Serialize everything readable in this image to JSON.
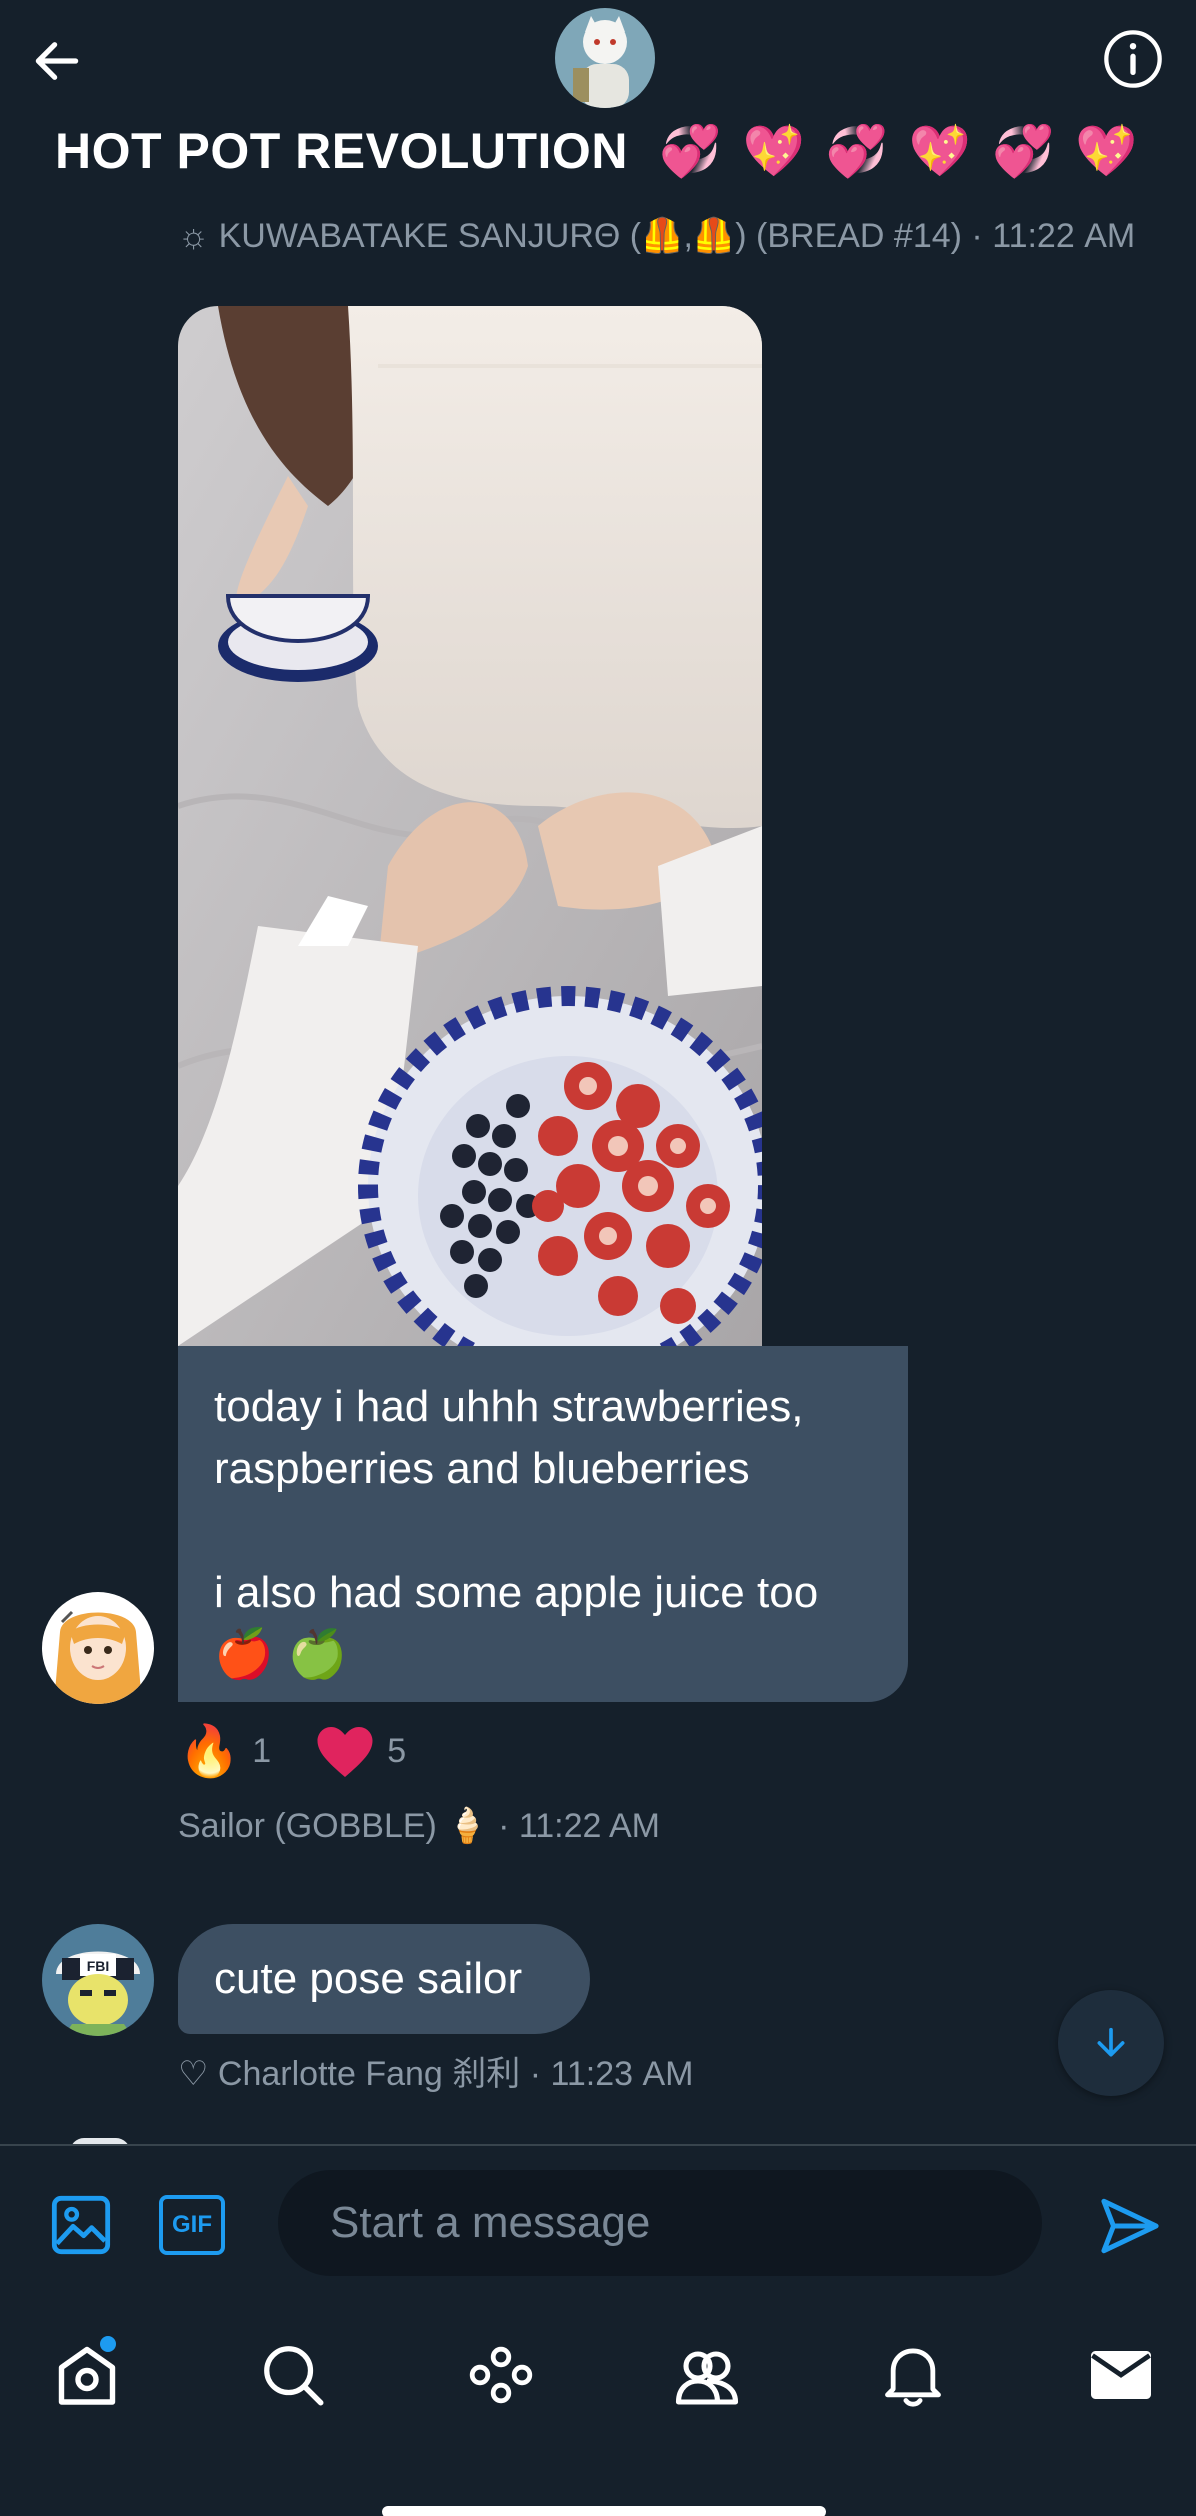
{
  "header": {
    "title": "HOT POT REVOLUTION",
    "title_emojis": [
      "💞",
      "💖",
      "💞",
      "💖",
      "💞",
      "💖"
    ]
  },
  "messages": [
    {
      "meta": "☼ KUWABATAKE SANJURΘ (🦺,🦺) (BREAD #14) · 11:22 AM"
    },
    {
      "text_lines": [
        "today i had uhhh strawberries,",
        "raspberries and blueberries",
        "",
        "i also had some apple juice too"
      ],
      "emojis": [
        "🍎",
        "🍏"
      ],
      "reactions": [
        {
          "emoji": "🔥",
          "count": "1"
        },
        {
          "emoji": "❤️",
          "count": "5"
        }
      ],
      "meta": "Sailor (GOBBLE) 🍦 · 11:22 AM"
    },
    {
      "text": "cute pose sailor",
      "meta": "♡ Charlotte Fang 刹利 · 11:23 AM"
    }
  ],
  "composer": {
    "placeholder": "Start a message",
    "gif_label": "GIF"
  },
  "nav": [
    "home-icon",
    "search-icon",
    "spaces-icon",
    "communities-icon",
    "notifications-icon",
    "messages-icon"
  ],
  "colors": {
    "background": "#15202b",
    "bubble": "#3d4f62",
    "accent": "#1d9bf0",
    "muted": "#8b98a5"
  }
}
